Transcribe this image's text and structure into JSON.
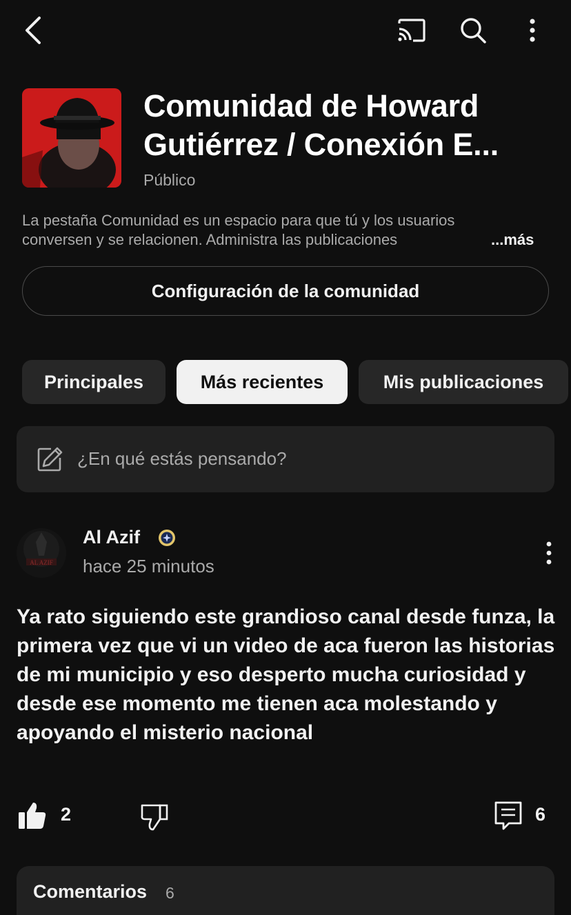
{
  "topbar": {
    "back_icon": "chevron-left-icon",
    "cast_icon": "cast-icon",
    "search_icon": "search-icon",
    "more_icon": "more-vertical-icon"
  },
  "community": {
    "title": "Comunidad de Howard Gutiérrez / Conexión E...",
    "visibility": "Público",
    "description": "La pestaña Comunidad es un espacio para que tú y los usuarios conversen y se relacionen. Administra las publicaciones",
    "more_label": "...más",
    "settings_label": "Configuración de la comunidad"
  },
  "tabs": [
    {
      "label": "Principales",
      "selected": false
    },
    {
      "label": "Más recientes",
      "selected": true
    },
    {
      "label": "Mis publicaciones",
      "selected": false
    }
  ],
  "composer": {
    "placeholder": "¿En qué estás pensando?",
    "icon": "edit-icon"
  },
  "post": {
    "author": "Al Azif",
    "time": "hace 25 minutos",
    "text": "Ya rato siguiendo este grandioso canal desde funza, la primera vez que vi un video de aca fueron las historias de mi municipio y eso desperto mucha curiosidad y desde ese momento me tienen aca molestando y apoyando el misterio nacional",
    "likes": "2",
    "comments": "6"
  },
  "comments_section": {
    "title": "Comentarios",
    "count": "6"
  },
  "colors": {
    "background": "#0f0f0f",
    "surface": "#212121",
    "chip": "#272727",
    "chip_selected": "#f1f1f1",
    "text_secondary": "#aaaaaa",
    "avatar_red": "#d81f1f"
  }
}
